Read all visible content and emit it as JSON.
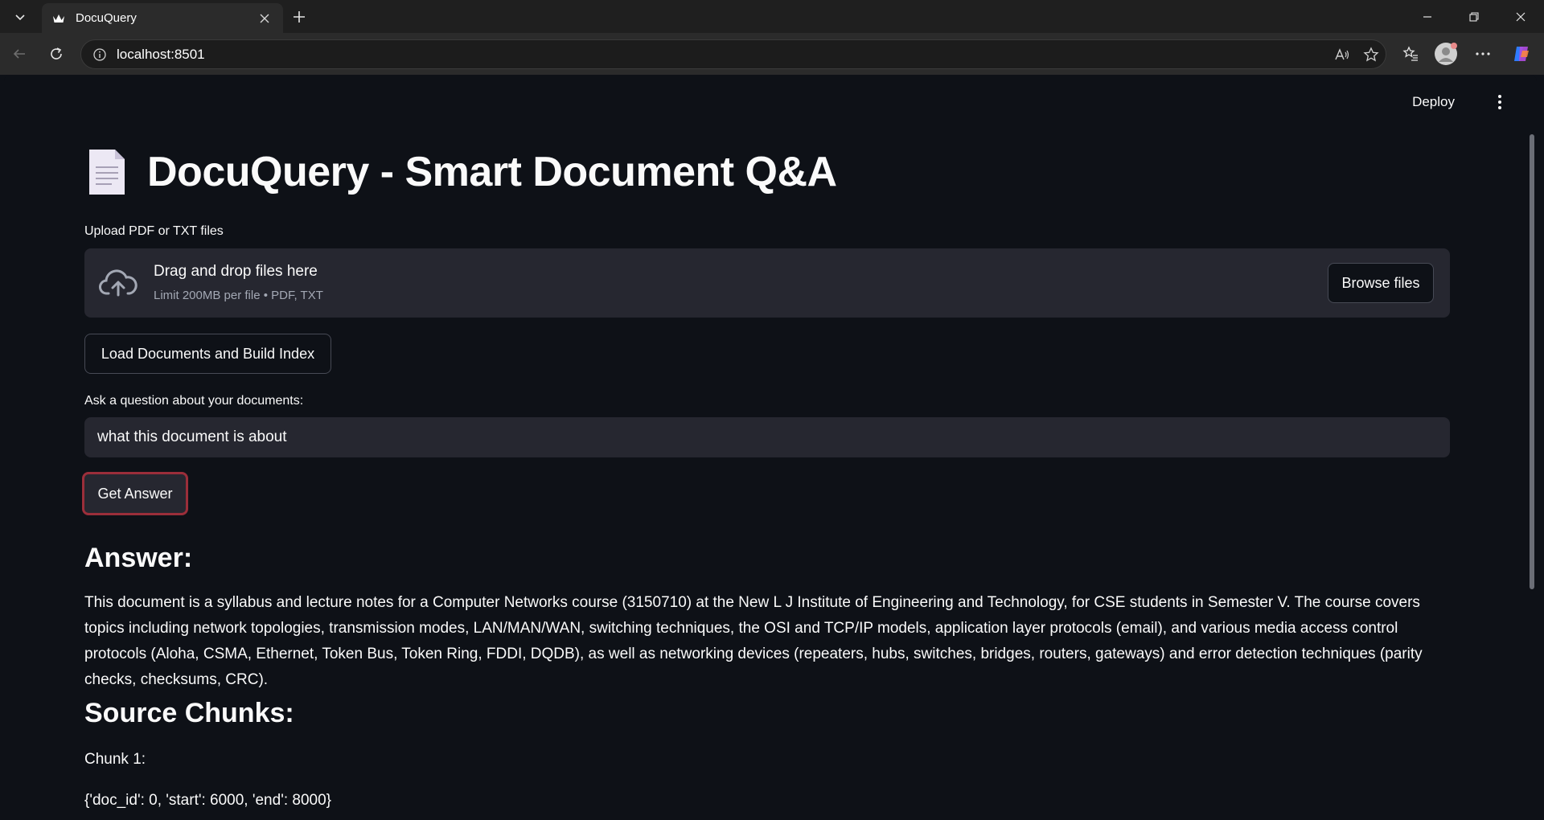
{
  "browser": {
    "tab_title": "DocuQuery",
    "url": "localhost:8501"
  },
  "app": {
    "deploy_label": "Deploy",
    "title": "DocuQuery - Smart Document Q&A",
    "upload": {
      "label": "Upload PDF or TXT files",
      "drag_text": "Drag and drop files here",
      "limit_text": "Limit 200MB per file • PDF, TXT",
      "browse_label": "Browse files"
    },
    "load_button_label": "Load Documents and Build Index",
    "question": {
      "label": "Ask a question about your documents:",
      "value": "what this document is about"
    },
    "get_answer_label": "Get Answer",
    "answer_heading": "Answer:",
    "answer_text": "This document is a syllabus and lecture notes for a Computer Networks course (3150710) at the New L J Institute of Engineering and Technology, for CSE students in Semester V. The course covers topics including network topologies, transmission modes, LAN/MAN/WAN, switching techniques, the OSI and TCP/IP models, application layer protocols (email), and various media access control protocols (Aloha, CSMA, Ethernet, Token Bus, Token Ring, FDDI, DQDB), as well as networking devices (repeaters, hubs, switches, bridges, routers, gateways) and error detection techniques (parity checks, checksums, CRC).",
    "sources_heading": "Source Chunks:",
    "chunks": [
      {
        "label": "Chunk 1:",
        "meta": "{'doc_id': 0, 'start': 6000, 'end': 8000}"
      }
    ]
  },
  "colors": {
    "background": "#0e1117",
    "widget_bg": "#262730",
    "focus_ring": "#9b2e3a",
    "text": "#fafafa"
  }
}
